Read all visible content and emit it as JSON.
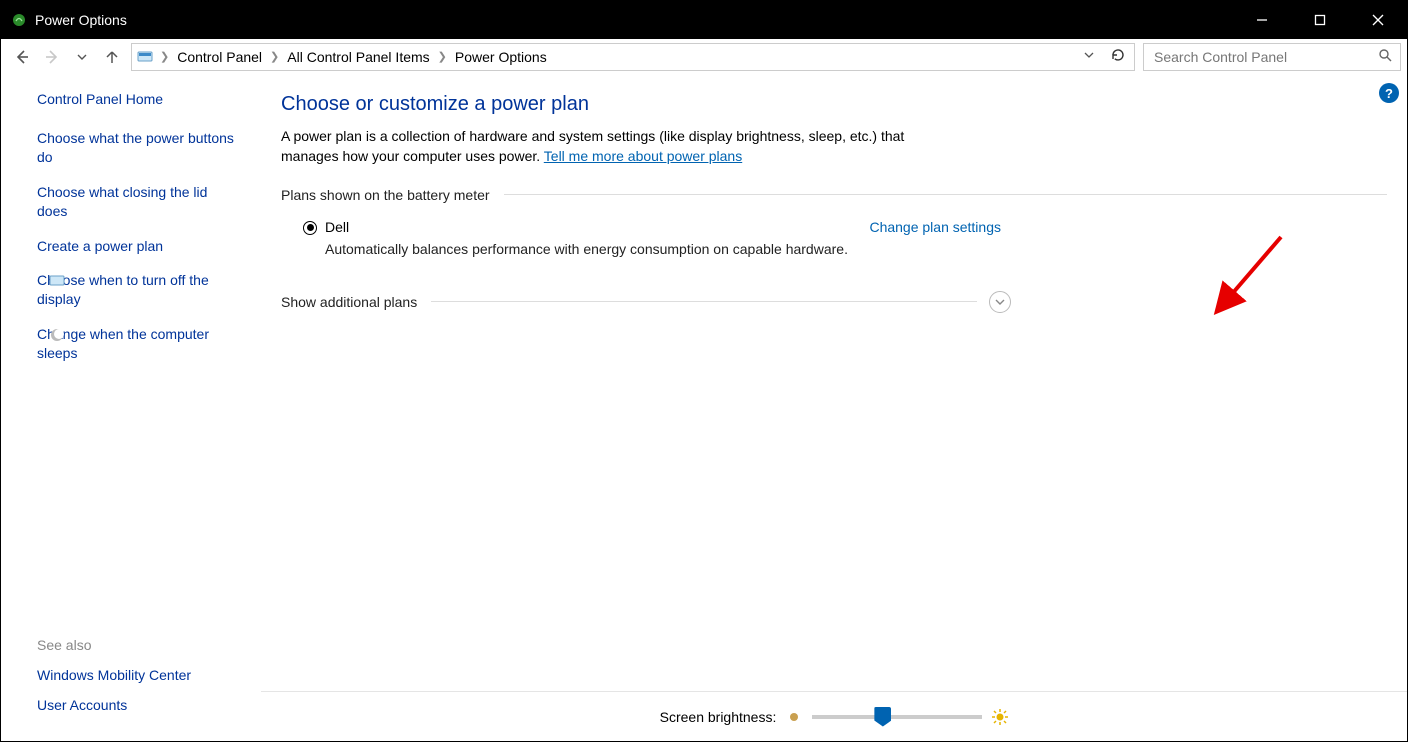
{
  "window": {
    "title": "Power Options"
  },
  "breadcrumb": {
    "root": "Control Panel",
    "mid": "All Control Panel Items",
    "leaf": "Power Options"
  },
  "search": {
    "placeholder": "Search Control Panel"
  },
  "sidebar": {
    "home": "Control Panel Home",
    "links": {
      "buttons": "Choose what the power buttons do",
      "lid": "Choose what closing the lid does",
      "create": "Create a power plan",
      "display_off": "Choose when to turn off the display",
      "sleeps": "Change when the computer sleeps"
    }
  },
  "seealso": {
    "title": "See also",
    "mobility": "Windows Mobility Center",
    "accounts": "User Accounts"
  },
  "main": {
    "title": "Choose or customize a power plan",
    "desc_prefix": "A power plan is a collection of hardware and system settings (like display brightness, sleep, etc.) that manages how your computer uses power. ",
    "desc_link": "Tell me more about power plans",
    "plans_header": "Plans shown on the battery meter",
    "plan": {
      "name": "Dell",
      "desc": "Automatically balances performance with energy consumption on capable hardware.",
      "change": "Change plan settings"
    },
    "additional": "Show additional plans"
  },
  "footer": {
    "brightness_label": "Screen brightness:"
  },
  "help": {
    "symbol": "?"
  }
}
